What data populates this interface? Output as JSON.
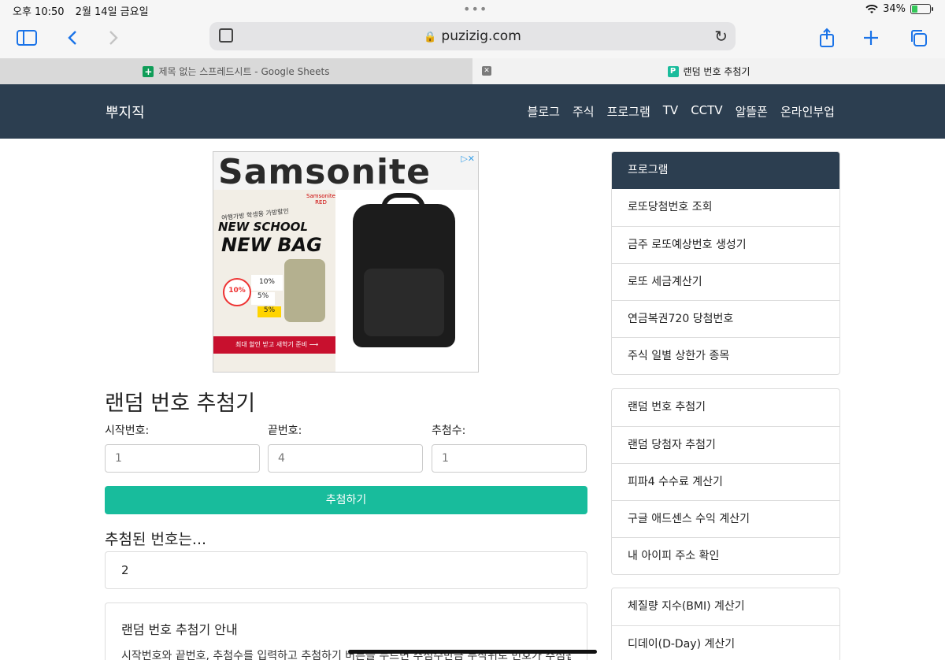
{
  "status_bar": {
    "time": "오후 10:50",
    "date": "2월 14일 금요일",
    "dots": "•••",
    "battery_percent": "34%",
    "battery_level": 0.34
  },
  "toolbar": {
    "url": "puzizig.com",
    "lock_icon": "lock-icon"
  },
  "tabs": [
    {
      "title": "제목 없는 스프레드시트 - Google Sheets",
      "favicon": "sheets-icon"
    },
    {
      "title": "랜덤 번호 추첨기",
      "favicon": "P"
    }
  ],
  "site_nav": {
    "brand": "뿌지직",
    "links": [
      "블로그",
      "주식",
      "프로그램",
      "TV",
      "CCTV",
      "알뜰폰",
      "온라인부업"
    ]
  },
  "ad": {
    "brand": "Samsonite",
    "sub_brand": "Samsonite RED",
    "kicker": "여행가방 학생용 가방할인",
    "headline1": "NEW SCHOOL",
    "headline2": "NEW BAG",
    "discount1": "10%",
    "discount2": "10%",
    "discount3": "5%",
    "discount4": "5%",
    "cta": "최대 할인 받고 새학기 준비"
  },
  "main": {
    "title": "랜덤 번호 추첨기",
    "start_label": "시작번호:",
    "end_label": "끝번호:",
    "count_label": "추첨수:",
    "start_value": "1",
    "end_value": "4",
    "count_value": "1",
    "button_label": "추첨하기",
    "result_heading": "추첨된 번호는...",
    "result_value": "2",
    "info_title": "랜덤 번호 추첨기 안내",
    "info_text": "시작번호와 끝번호, 추첨수를 입력하고 추첨하기 버튼을 누르면 추첨수만큼 무작위로 번호가 추첨됩"
  },
  "sidebar": {
    "group1_head": "프로그램",
    "group1_items": [
      "로또당첨번호 조회",
      "금주 로또예상번호 생성기",
      "로또 세금계산기",
      "연금복권720 당첨번호",
      "주식 일별 상한가 종목"
    ],
    "group2_items": [
      "랜덤 번호 추첨기",
      "랜덤 당첨자 추첨기",
      "피파4 수수료 계산기",
      "구글 애드센스 수익 계산기",
      "내 아이피 주소 확인"
    ],
    "group3_items": [
      "체질량 지수(BMI) 계산기",
      "디데이(D-Day) 계산기"
    ]
  }
}
